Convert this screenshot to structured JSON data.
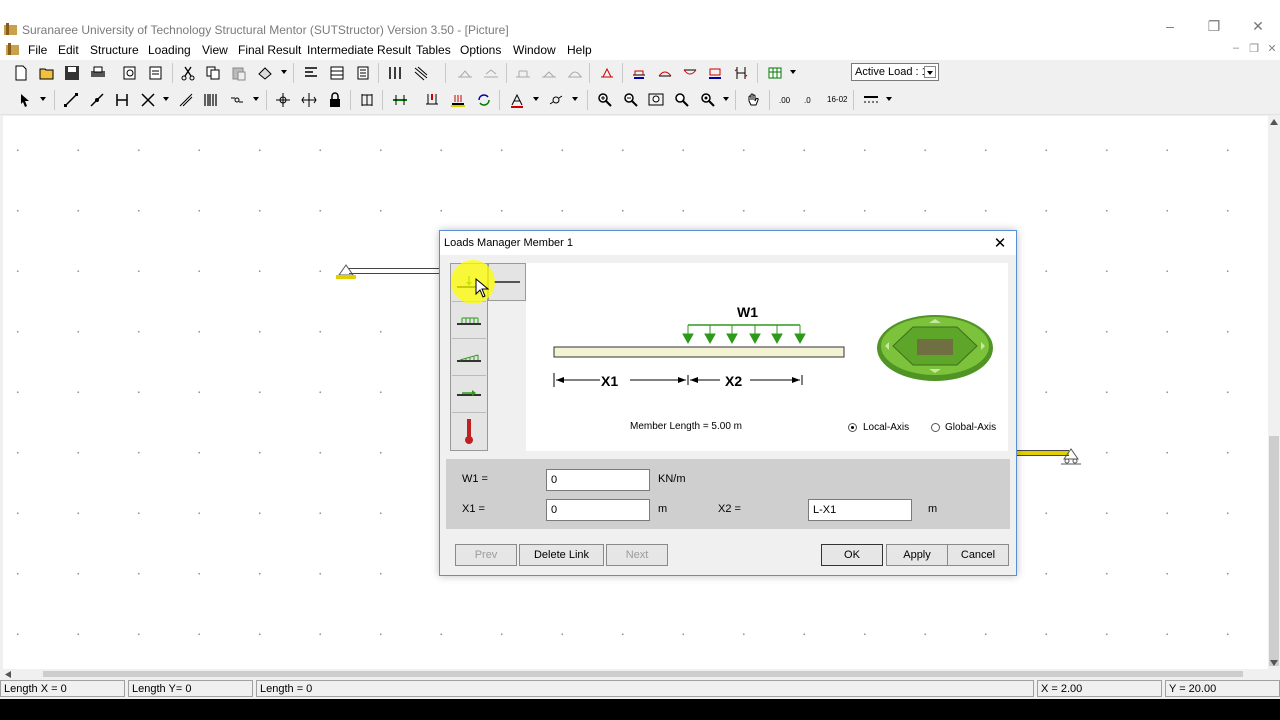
{
  "window": {
    "title": "Suranaree University of Technology Structural Mentor (SUTStructor) Version 3.50 - [Picture]",
    "controls": {
      "minimize": "–",
      "restore": "❐",
      "close": "✕"
    }
  },
  "menubar": {
    "items": [
      "File",
      "Edit",
      "Structure",
      "Loading",
      "View",
      "Final Result",
      "Intermediate Result",
      "Tables",
      "Options",
      "Window",
      "Help"
    ],
    "mdi_controls": {
      "minimize": "–",
      "restore": "❐",
      "close": "✕"
    }
  },
  "toolbar": {
    "active_load": "Active Load : 1",
    "coord_label": "16-02"
  },
  "statusbar": {
    "length_x": "Length X = 0",
    "length_y": "Length Y= 0",
    "length": "Length = 0",
    "x": "X = 2.00",
    "y": "Y = 20.00"
  },
  "dialog": {
    "title": "Loads Manager  Member 1",
    "close": "✕",
    "preview": {
      "load_label": "W1",
      "x1_label": "X1",
      "x2_label": "X2",
      "member_length": "Member Length = 5.00 m",
      "local_axis": "Local-Axis",
      "global_axis": "Global-Axis",
      "local_axis_selected": true
    },
    "inputs": {
      "w1_label": "W1 =",
      "w1_value": "0",
      "w1_unit": "KN/m",
      "x1_label": "X1 =",
      "x1_value": "0",
      "x1_unit": "m",
      "x2_label": "X2 =",
      "x2_value": "L-X1",
      "x2_unit": "m"
    },
    "buttons": {
      "prev": "Prev",
      "delete_link": "Delete Link",
      "next": "Next",
      "ok": "OK",
      "apply": "Apply",
      "cancel": "Cancel"
    }
  },
  "colors": {
    "load_arrow": "#2e9a1a",
    "beam_fill": "#f3f3d3",
    "support": "#e0d000",
    "nav_pad": "#5ea62a",
    "dialog_border": "#5a8fd1"
  }
}
